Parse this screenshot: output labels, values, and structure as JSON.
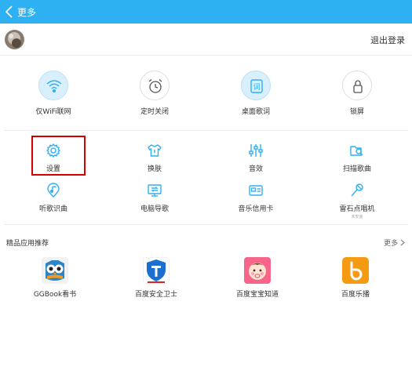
{
  "header": {
    "title": "更多",
    "back_icon": "chevron-left-icon"
  },
  "account": {
    "logout_label": "退出登录"
  },
  "toggles": [
    {
      "label": "仅WiFi联网",
      "icon": "wifi-icon",
      "active": true
    },
    {
      "label": "定时关闭",
      "icon": "alarm-clock-icon",
      "active": false
    },
    {
      "label": "桌面歌词",
      "icon": "desktop-lyrics-icon",
      "active": true
    },
    {
      "label": "锁屏",
      "icon": "lock-icon",
      "active": false
    }
  ],
  "tools": [
    {
      "label": "设置",
      "icon": "gear-icon"
    },
    {
      "label": "换肤",
      "icon": "tshirt-icon"
    },
    {
      "label": "音效",
      "icon": "equalizer-icon"
    },
    {
      "label": "扫描歌曲",
      "icon": "scan-folder-icon"
    },
    {
      "label": "听歌识曲",
      "icon": "music-recognition-icon"
    },
    {
      "label": "电脑导歌",
      "icon": "computer-transfer-icon"
    },
    {
      "label": "音乐信用卡",
      "icon": "credit-card-icon"
    },
    {
      "label": "雷石点唱机",
      "icon": "microphone-icon",
      "sublabel": "未安装"
    }
  ],
  "apps_section": {
    "title": "精品应用推荐",
    "more_label": "更多",
    "apps": [
      {
        "label": "GGBook看书",
        "icon": "ggbook-owl-icon"
      },
      {
        "label": "百度安全卫士",
        "icon": "baidu-shield-icon"
      },
      {
        "label": "百度宝宝知道",
        "icon": "baby-face-icon"
      },
      {
        "label": "百度乐播",
        "icon": "baidu-lebo-icon"
      }
    ]
  },
  "colors": {
    "header": "#2eb1f3",
    "accent": "#2eb1f3",
    "highlight": "#d40000"
  }
}
